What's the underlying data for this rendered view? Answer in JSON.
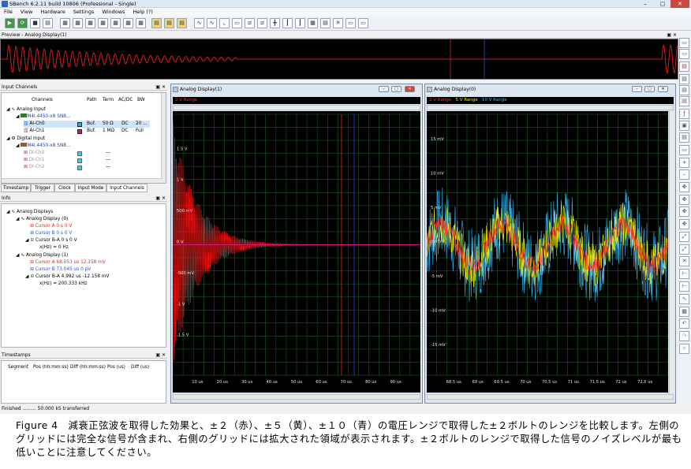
{
  "window": {
    "title": "SBench 6.2.11 build 10806 (Professional - Single)",
    "minimize": "–",
    "maximize": "▢",
    "close": "✕"
  },
  "menu": [
    "File",
    "View",
    "Hardware",
    "Settings",
    "Windows",
    "Help (?)"
  ],
  "preview": {
    "title": "Preview - Analog Display(1)"
  },
  "input_channels": {
    "title": "Input Channels",
    "columns": [
      "Channels",
      "Path",
      "Term",
      "AC/DC",
      "BW"
    ],
    "rows": [
      {
        "label": "Analog Input",
        "level": 0
      },
      {
        "label": "M4i.4450-x8 SN8...",
        "level": 1
      },
      {
        "label": "AI-Ch0",
        "level": 2,
        "path": "Buf.",
        "term": "50 Ω",
        "acdc": "DC",
        "bw": "20 ..."
      },
      {
        "label": "AI-Ch1",
        "level": 2,
        "path": "Buf.",
        "term": "1 MΩ",
        "acdc": "DC",
        "bw": "Full"
      },
      {
        "label": "Digital Input",
        "level": 0
      },
      {
        "label": "M4i.4450-x8 SN8...",
        "level": 1
      },
      {
        "label": "DI-Ch0",
        "level": 2,
        "path": "---"
      },
      {
        "label": "DI-Ch1",
        "level": 2,
        "path": "---"
      },
      {
        "label": "DI-Ch2",
        "level": 2,
        "path": "---"
      }
    ],
    "tabs": [
      "Timestamp",
      "Trigger",
      "Clock",
      "Input Mode",
      "Input Channels"
    ],
    "active_tab": "Input Channels"
  },
  "info": {
    "title": "Info",
    "rows": [
      {
        "label": "Analog Displays",
        "level": 0
      },
      {
        "label": "Analog Display (0)",
        "level": 1
      },
      {
        "label": "Cursor A  0 s  0 V",
        "level": 2,
        "color": "#d03030"
      },
      {
        "label": "Cursor B  0 s  0 V",
        "level": 2,
        "color": "#3050c8"
      },
      {
        "label": "Cursor B-A  0 s  0 V",
        "level": 2,
        "color": "#000000"
      },
      {
        "label": "x(Hz) = 0 Hz",
        "level": 3,
        "color": "#000000"
      },
      {
        "label": "Analog Display (1)",
        "level": 1
      },
      {
        "label": "Cursor A  68.053 us  12.158 mV",
        "level": 2,
        "color": "#d03030"
      },
      {
        "label": "Cursor B  73.045 us  0 pV",
        "level": 2,
        "color": "#3050c8"
      },
      {
        "label": "Cursor B-A  4.992 us  -12.158 mV",
        "level": 2,
        "color": "#000000"
      },
      {
        "label": "x(Hz) = 200.333 kHz",
        "level": 3,
        "color": "#000000"
      }
    ]
  },
  "timestamps": {
    "title": "Timestamps",
    "columns": [
      "Segment",
      "Pos (hh:mm:ss)",
      "Diff (hh:mm:ss)",
      "Pos (us)",
      "Diff (us)"
    ]
  },
  "display_left": {
    "title": "Analog Display(1)",
    "range_label": "2 V Range",
    "y_ticks": [
      "1.5 V",
      "1 V",
      "500 mV",
      "0 V",
      "-500 mV",
      "-1 V",
      "-1.5 V"
    ],
    "x_ticks": [
      "10 us",
      "20 us",
      "30 us",
      "40 us",
      "50 us",
      "60 us",
      "70 us",
      "80 us",
      "90 us"
    ]
  },
  "display_right": {
    "title": "Analog Display(0)",
    "range_labels": [
      {
        "text": "2 V Range",
        "color": "#ff2a2a"
      },
      {
        "text": "5 V Range",
        "color": "#f2f200"
      },
      {
        "text": "10 V Range",
        "color": "#38b8f0"
      }
    ],
    "y_ticks": [
      "15 mV",
      "10 mV",
      "5 mV",
      "0 mV",
      "-5 mV",
      "-10 mV",
      "-15 mV"
    ],
    "x_ticks": [
      "68.5 us",
      "69 us",
      "69.5 us",
      "70 us",
      "70.5 us",
      "71 us",
      "71.5 us",
      "72 us",
      "72.5 us"
    ]
  },
  "status": "Finished ......... 50.000 kS transferred",
  "caption": "Figure 4　減衰正弦波を取得した効果と、±２（赤）、±５（黄）、±１０（青）の電圧レンジで取得した±２ボルトのレンジを比較します。左側のグリッドには完全な信号が含まれ、右側のグリッドには拡大された領域が表示されます。±２ボルトのレンジで取得した信号のノイズレベルが最も低いことに注意してください。"
}
